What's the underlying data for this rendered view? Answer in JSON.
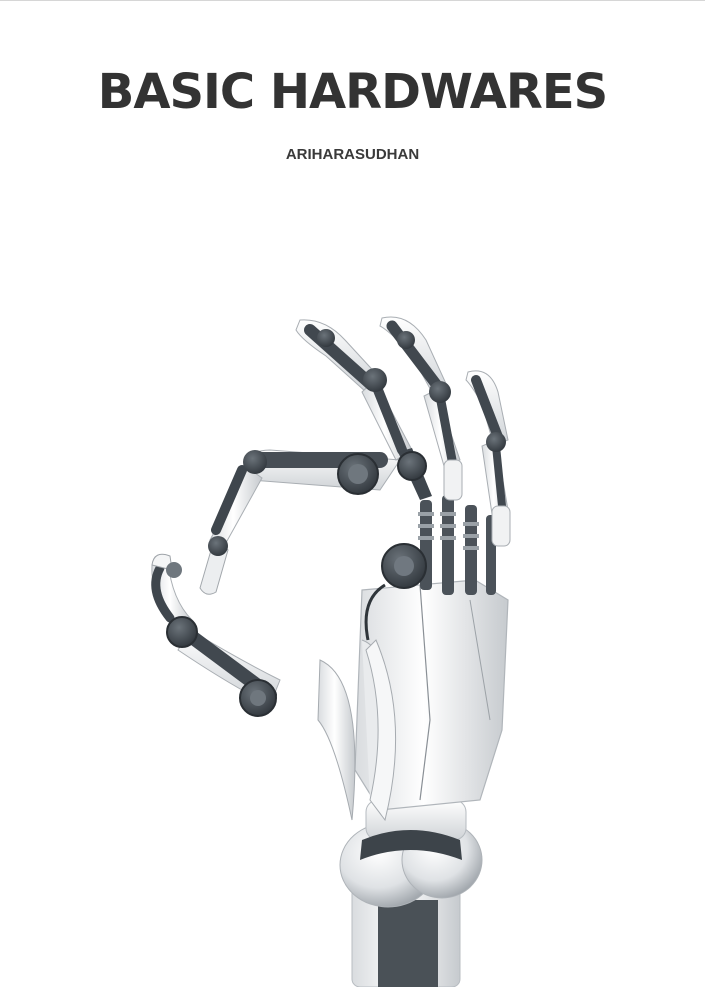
{
  "cover": {
    "title": "BASIC HARDWARES",
    "author": "ARIHARASUDHAN"
  },
  "illustration": {
    "subject": "robotic-hand-ok-gesture-icon"
  },
  "colors": {
    "title": "#333333",
    "author": "#3a3a3a",
    "metal_white": "#f2f3f4",
    "metal_shadow": "#c9cdd1",
    "joint_dark": "#3f464d",
    "joint_mid": "#5d656c",
    "background": "#ffffff"
  }
}
